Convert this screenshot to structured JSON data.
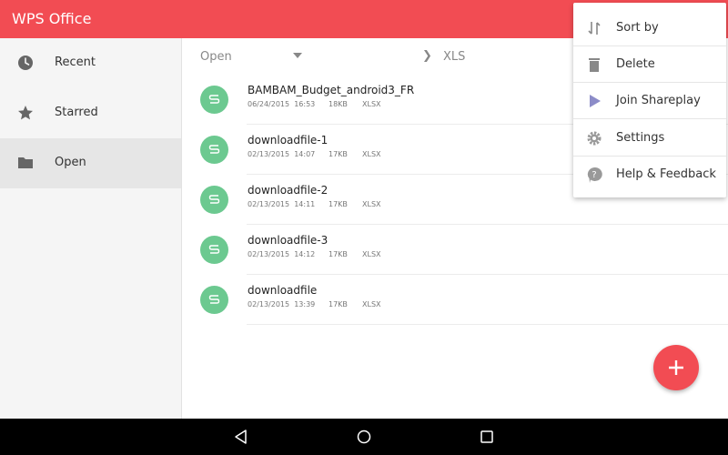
{
  "appbar": {
    "title": "WPS Office",
    "color": "#f24c53"
  },
  "sidebar": {
    "items": [
      {
        "label": "Recent",
        "icon": "clock-icon"
      },
      {
        "label": "Starred",
        "icon": "star-icon"
      },
      {
        "label": "Open",
        "icon": "folder-icon",
        "active": true
      }
    ]
  },
  "breadcrumb": {
    "root": "Open",
    "separator": "❯",
    "current": "XLS"
  },
  "files": [
    {
      "name": "BAMBAM_Budget_android3_FR",
      "date": "06/24/2015",
      "time": "16:53",
      "size": "18KB",
      "type": "XLSX"
    },
    {
      "name": "downloadfile-1",
      "date": "02/13/2015",
      "time": "14:07",
      "size": "17KB",
      "type": "XLSX"
    },
    {
      "name": "downloadfile-2",
      "date": "02/13/2015",
      "time": "14:11",
      "size": "17KB",
      "type": "XLSX"
    },
    {
      "name": "downloadfile-3",
      "date": "02/13/2015",
      "time": "14:12",
      "size": "17KB",
      "type": "XLSX"
    },
    {
      "name": "downloadfile",
      "date": "02/13/2015",
      "time": "13:39",
      "size": "17KB",
      "type": "XLSX"
    }
  ],
  "menu": {
    "items": [
      {
        "label": "Sort by",
        "icon": "sort-icon"
      },
      {
        "label": "Delete",
        "icon": "trash-icon"
      },
      {
        "label": "Join Shareplay",
        "icon": "play-icon"
      },
      {
        "label": "Settings",
        "icon": "gear-icon"
      },
      {
        "label": "Help & Feedback",
        "icon": "help-icon"
      }
    ]
  },
  "fab": {
    "icon": "plus-icon",
    "color": "#f24c53"
  },
  "navbar": {
    "buttons": [
      "back-icon",
      "home-icon",
      "recents-icon"
    ]
  },
  "colors": {
    "file_icon": "#6cc990",
    "accent": "#f24c53"
  }
}
